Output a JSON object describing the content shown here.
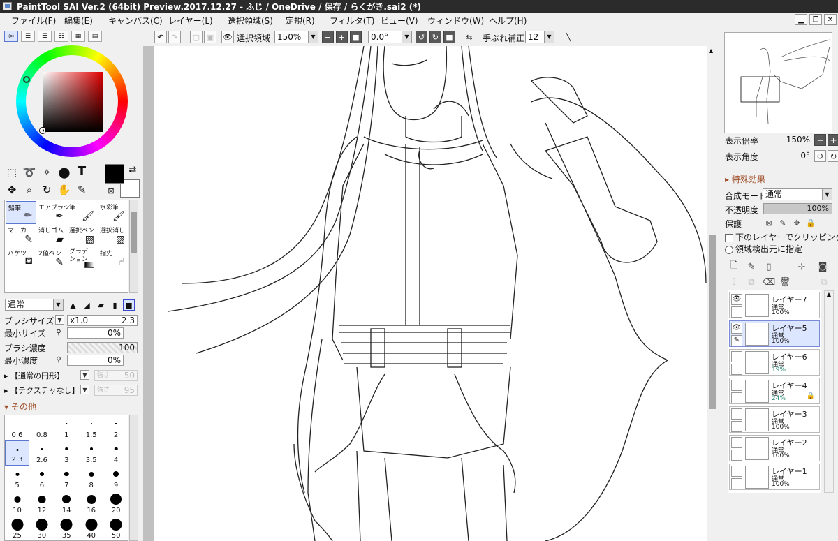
{
  "title": "PaintTool SAI Ver.2 (64bit) Preview.2017.12.27 - ふじ / OneDrive / 保存 / らくがき.sai2 (*)",
  "menu": [
    "ファイル(F)",
    "編集(E)",
    "キャンバス(C)",
    "レイヤー(L)",
    "選択領域(S)",
    "定規(R)",
    "フィルタ(T)",
    "ビュー(V)",
    "ウィンドウ(W)",
    "ヘルプ(H)"
  ],
  "toolbar": {
    "selection_label": "選択領域",
    "zoom": "150%",
    "angle": "0.0°",
    "stabilizer_label": "手ぶれ補正",
    "stabilizer": "12"
  },
  "brushes": [
    {
      "name": "鉛筆",
      "icon": "pencil-icon"
    },
    {
      "name": "エアブラシ",
      "icon": "airbrush-icon"
    },
    {
      "name": "筆",
      "icon": "brush-icon"
    },
    {
      "name": "水彩筆",
      "icon": "watercolor-icon"
    },
    {
      "name": "マーカー",
      "icon": "marker-icon"
    },
    {
      "name": "消しゴム",
      "icon": "eraser-icon"
    },
    {
      "name": "選択ペン",
      "icon": "select-pen-icon"
    },
    {
      "name": "選択消し",
      "icon": "select-erase-icon"
    },
    {
      "name": "バケツ",
      "icon": "bucket-icon"
    },
    {
      "name": "2値ペン",
      "icon": "binary-pen-icon"
    },
    {
      "name": "グラデーション",
      "icon": "gradient-icon"
    },
    {
      "name": "指先",
      "icon": "finger-icon"
    }
  ],
  "brush_settings": {
    "blend_mode": "通常",
    "size_label": "ブラシサイズ",
    "size_mult": "x1.0",
    "size_value": "2.3",
    "min_size_label": "最小サイズ",
    "min_size_value": "0%",
    "density_label": "ブラシ濃度",
    "density_value": "100",
    "min_density_label": "最小濃度",
    "min_density_value": "0%",
    "shape": "【通常の円形】",
    "shape_strength_label": "強さ",
    "shape_strength": "50",
    "texture": "【テクスチャなし】",
    "texture_strength_label": "強さ",
    "texture_strength": "95",
    "other_label": "その他"
  },
  "brush_sizes": [
    "0.6",
    "0.8",
    "1",
    "1.5",
    "2",
    "2.3",
    "2.6",
    "3",
    "3.5",
    "4",
    "5",
    "6",
    "7",
    "8",
    "9",
    "10",
    "12",
    "14",
    "16",
    "20",
    "25",
    "30",
    "35",
    "40",
    "50"
  ],
  "navigator": {
    "zoom_label": "表示倍率",
    "zoom_value": "150%",
    "angle_label": "表示角度",
    "angle_value": "0°"
  },
  "effects_label": "特殊効果",
  "layer_props": {
    "blend_label": "合成モード",
    "blend_value": "通常",
    "opacity_label": "不透明度",
    "opacity_value": "100%",
    "protect_label": "保護",
    "clip_label": "下のレイヤーでクリッピング",
    "source_label": "領域検出元に指定"
  },
  "layers": [
    {
      "name": "レイヤー7",
      "mode": "通常",
      "opacity": "100%",
      "visible": true,
      "selected": false,
      "teal": false,
      "locked": false
    },
    {
      "name": "レイヤー5",
      "mode": "通常",
      "opacity": "100%",
      "visible": true,
      "selected": true,
      "teal": false,
      "locked": false
    },
    {
      "name": "レイヤー6",
      "mode": "通常",
      "opacity": "19%",
      "visible": false,
      "selected": false,
      "teal": true,
      "locked": false
    },
    {
      "name": "レイヤー4",
      "mode": "通常",
      "opacity": "24%",
      "visible": false,
      "selected": false,
      "teal": true,
      "locked": true
    },
    {
      "name": "レイヤー3",
      "mode": "通常",
      "opacity": "100%",
      "visible": false,
      "selected": false,
      "teal": false,
      "locked": false
    },
    {
      "name": "レイヤー2",
      "mode": "通常",
      "opacity": "100%",
      "visible": false,
      "selected": false,
      "teal": false,
      "locked": false
    },
    {
      "name": "レイヤー1",
      "mode": "通常",
      "opacity": "100%",
      "visible": false,
      "selected": false,
      "teal": false,
      "locked": false
    }
  ],
  "colors": {
    "accent": "#dde6ff",
    "primary_color": "#000000",
    "secondary_color": "#ffffff",
    "teal": "#2a8a7a"
  }
}
